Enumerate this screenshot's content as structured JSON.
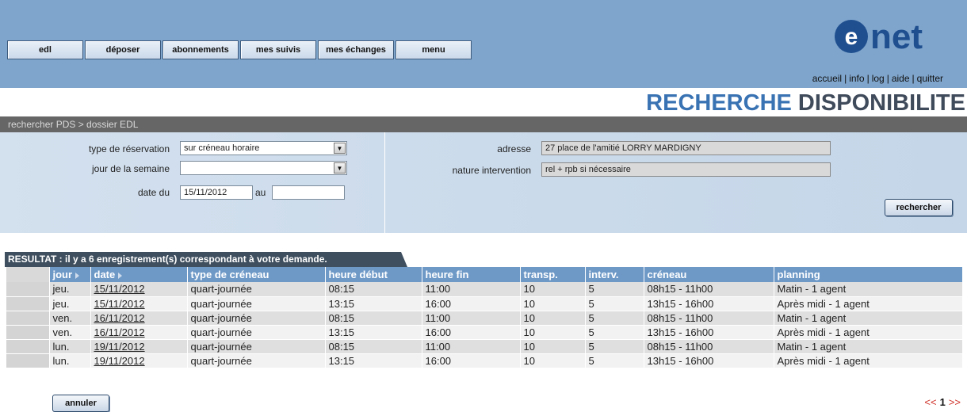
{
  "nav": {
    "items": [
      "edl",
      "déposer",
      "abonnements",
      "mes suivis",
      "mes échanges",
      "menu"
    ]
  },
  "brand": {
    "logo_text": "enet",
    "accent": "#1f4f8f"
  },
  "top_links": [
    "accueil",
    "info",
    "log",
    "aide",
    "quitter"
  ],
  "page_title": {
    "part1": "RECHERCHE",
    "part2": "DISPONIBILITE"
  },
  "breadcrumb": "rechercher PDS > dossier EDL",
  "form": {
    "reservation_type_label": "type de réservation",
    "reservation_type_value": "sur créneau horaire",
    "weekday_label": "jour de la semaine",
    "weekday_value": "",
    "date_from_label": "date du",
    "date_from_value": "15/11/2012",
    "date_to_label": "au",
    "date_to_value": "",
    "address_label": "adresse",
    "address_value": "27 place de l'amitié LORRY MARDIGNY",
    "intervention_label": "nature intervention",
    "intervention_value": "rel + rpb si nécessaire",
    "search_button": "rechercher"
  },
  "results": {
    "summary": "RESULTAT : il y a 6 enregistrement(s) correspondant à votre demande.",
    "columns": [
      "jour",
      "date",
      "type de créneau",
      "heure début",
      "heure fin",
      "transp.",
      "interv.",
      "créneau",
      "planning"
    ],
    "rows": [
      [
        "jeu.",
        "15/11/2012",
        "quart-journée",
        "08:15",
        "11:00",
        "10",
        "5",
        "08h15 - 11h00",
        "Matin - 1 agent"
      ],
      [
        "jeu.",
        "15/11/2012",
        "quart-journée",
        "13:15",
        "16:00",
        "10",
        "5",
        "13h15 - 16h00",
        "Après midi - 1 agent"
      ],
      [
        "ven.",
        "16/11/2012",
        "quart-journée",
        "08:15",
        "11:00",
        "10",
        "5",
        "08h15 - 11h00",
        "Matin - 1 agent"
      ],
      [
        "ven.",
        "16/11/2012",
        "quart-journée",
        "13:15",
        "16:00",
        "10",
        "5",
        "13h15 - 16h00",
        "Après midi - 1 agent"
      ],
      [
        "lun.",
        "19/11/2012",
        "quart-journée",
        "08:15",
        "11:00",
        "10",
        "5",
        "08h15 - 11h00",
        "Matin - 1 agent"
      ],
      [
        "lun.",
        "19/11/2012",
        "quart-journée",
        "13:15",
        "16:00",
        "10",
        "5",
        "13h15 - 16h00",
        "Après midi - 1 agent"
      ]
    ]
  },
  "cancel_button": "annuler",
  "pagination": {
    "prev": "<<",
    "page": "1",
    "next": ">>"
  },
  "icons": [
    "dropdown-arrow-icon",
    "sort-arrow-icon",
    "prev-page-icon",
    "next-page-icon"
  ]
}
